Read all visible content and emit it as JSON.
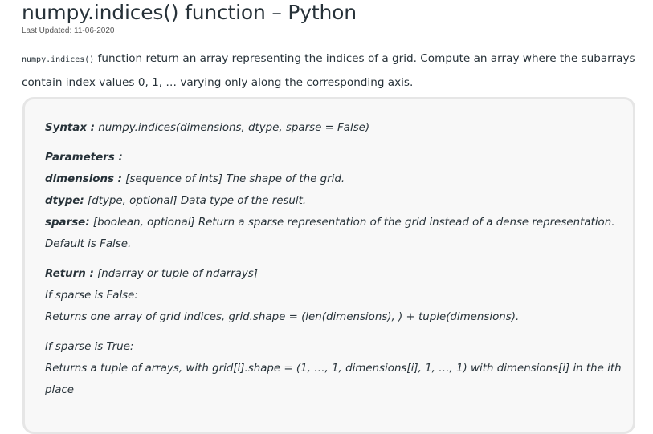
{
  "article": {
    "title": "numpy.indices() function – Python",
    "last_updated": "Last Updated: 11-06-2020",
    "intro": {
      "code": "numpy.indices()",
      "text": " function return an array representing the indices of a grid. Compute an array where the subarrays contain index values 0, 1, … varying only along the corresponding axis."
    }
  },
  "syntax": {
    "label": "Syntax :",
    "value": " numpy.indices(dimensions, dtype, sparse = False)"
  },
  "parameters": {
    "label": "Parameters :",
    "items": [
      {
        "name": "dimensions :",
        "desc": " [sequence of ints] The shape of the grid."
      },
      {
        "name": "dtype:",
        "desc": " [dtype, optional] Data type of the result."
      },
      {
        "name": "sparse:",
        "desc": " [boolean, optional] Return a sparse representation of the grid instead of a dense representation. Default is False."
      }
    ]
  },
  "return": {
    "label": "Return :",
    "value": " [ndarray or tuple of ndarrays]",
    "false_case": "If sparse is False:",
    "false_desc": "Returns one array of grid indices, grid.shape = (len(dimensions), ) + tuple(dimensions).",
    "true_case": "If sparse is True:",
    "true_desc": "Returns a tuple of arrays, with grid[i].shape = (1, …, 1, dimensions[i], 1, …, 1) with dimensions[i] in the ith place"
  }
}
